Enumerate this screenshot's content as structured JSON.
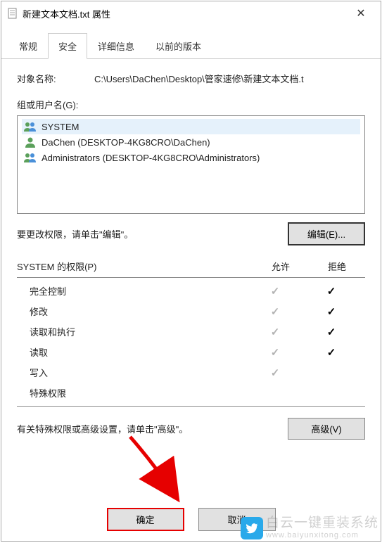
{
  "window": {
    "title": "新建文本文档.txt 属性"
  },
  "tabs": {
    "general": "常规",
    "security": "安全",
    "details": "详细信息",
    "previous": "以前的版本"
  },
  "object": {
    "label": "对象名称:",
    "path": "C:\\Users\\DaChen\\Desktop\\管家速修\\新建文本文档.t"
  },
  "groups": {
    "label": "组或用户名(G):",
    "items": [
      {
        "name": "SYSTEM"
      },
      {
        "name": "DaChen (DESKTOP-4KG8CRO\\DaChen)"
      },
      {
        "name": "Administrators (DESKTOP-4KG8CRO\\Administrators)"
      }
    ]
  },
  "edit": {
    "hint": "要更改权限，请单击\"编辑\"。",
    "button": "编辑(E)..."
  },
  "perms": {
    "header": "SYSTEM 的权限(P)",
    "allow": "允许",
    "deny": "拒绝",
    "rows": [
      {
        "name": "完全控制",
        "allow": true,
        "deny": true
      },
      {
        "name": "修改",
        "allow": true,
        "deny": true
      },
      {
        "name": "读取和执行",
        "allow": true,
        "deny": true
      },
      {
        "name": "读取",
        "allow": true,
        "deny": true
      },
      {
        "name": "写入",
        "allow": true,
        "deny": false
      },
      {
        "name": "特殊权限",
        "allow": false,
        "deny": false
      }
    ]
  },
  "advanced": {
    "hint": "有关特殊权限或高级设置，请单击\"高级\"。",
    "button": "高级(V)"
  },
  "buttons": {
    "ok": "确定",
    "cancel": "取消"
  },
  "watermark": {
    "text": "白云一键重装系统",
    "url": "www.baiyunxitong.com"
  }
}
